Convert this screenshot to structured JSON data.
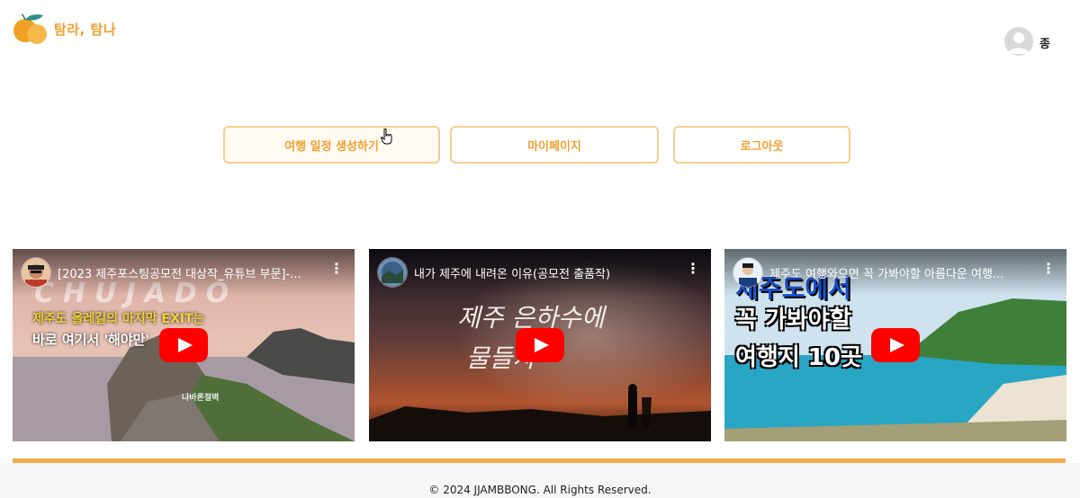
{
  "header": {
    "brand": "탐라, 탐나",
    "user_initial": "종"
  },
  "nav": {
    "create_itinerary": "여행 일정 생성하기",
    "mypage": "마이페이지",
    "logout": "로그아웃"
  },
  "videos": [
    {
      "title": "[2023 제주포스팅공모전 대상작_유튜브 부문]-...",
      "overlay_brand": "CHUJADO",
      "overlay_line1": "제주도 올레길의 마지막 EXIT는",
      "overlay_line2": "바로 여기서 '해야만'",
      "overlay_small": "나바론절벽"
    },
    {
      "title": "내가 제주에 내려온 이유(공모전 출품작)",
      "overlay_line1": "제주 은하수에",
      "overlay_line2": "물들자"
    },
    {
      "title": "제주도 여행와으면 꼭 가봐야할 아름다운 여행...",
      "overlay_line1": "제주도에서",
      "overlay_line2": "꼭 가봐야할",
      "overlay_line3": "여행지 10곳"
    }
  ],
  "footer": {
    "copyright": "© 2024 JJAMBBONG. All Rights Reserved."
  },
  "colors": {
    "accent": "#f0a030",
    "button_border": "#f5cf8f",
    "footer_bar": "#f2ab4c",
    "play": "#ff0000"
  },
  "icons": [
    "tangerine-logo-icon",
    "avatar-icon",
    "pointer-cursor-icon",
    "play-icon",
    "more-vert-icon"
  ]
}
